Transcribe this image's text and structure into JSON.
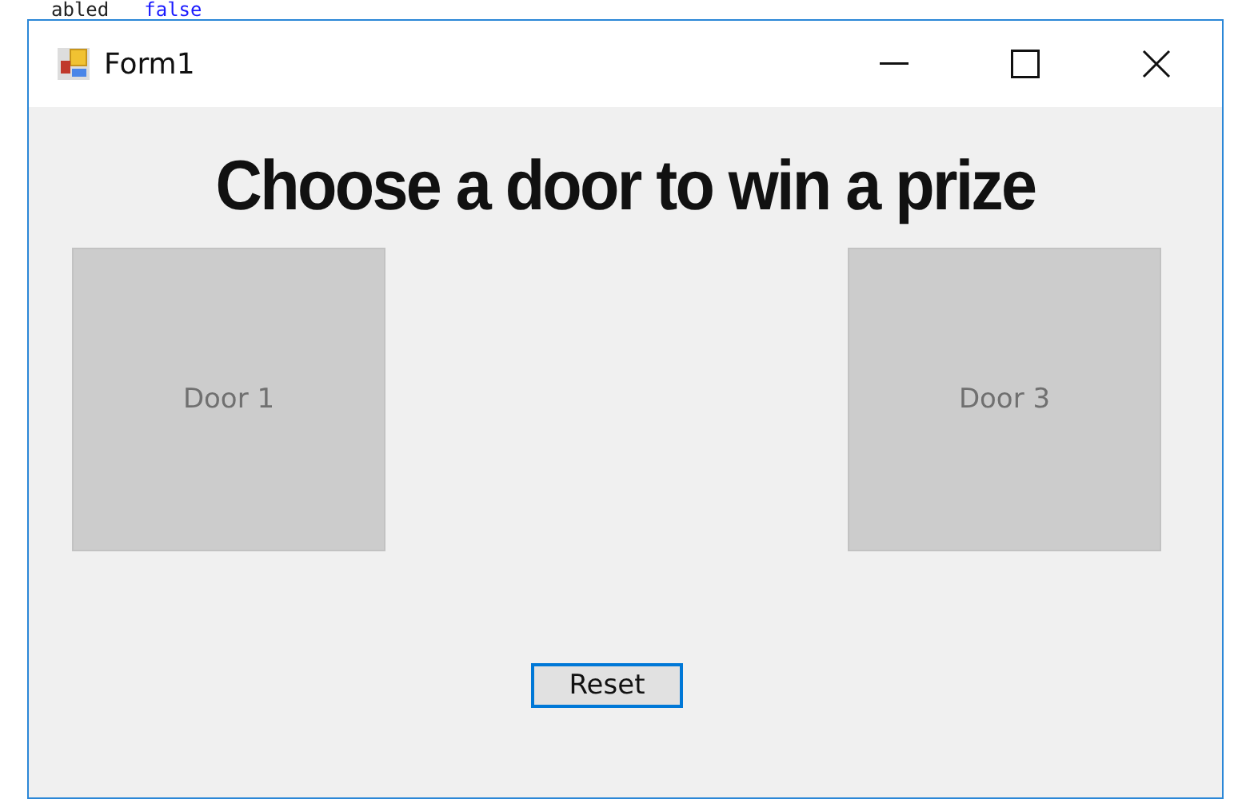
{
  "editor_background": {
    "fragments": [
      {
        "text": "abled",
        "kind": "plain"
      },
      {
        "text": "false",
        "kind": "keyword"
      }
    ]
  },
  "window": {
    "title": "Form1"
  },
  "heading": "Choose a door to win a prize",
  "doors": [
    {
      "label": "Door 1"
    },
    {
      "label": "Door 3"
    }
  ],
  "reset_button": "Reset"
}
